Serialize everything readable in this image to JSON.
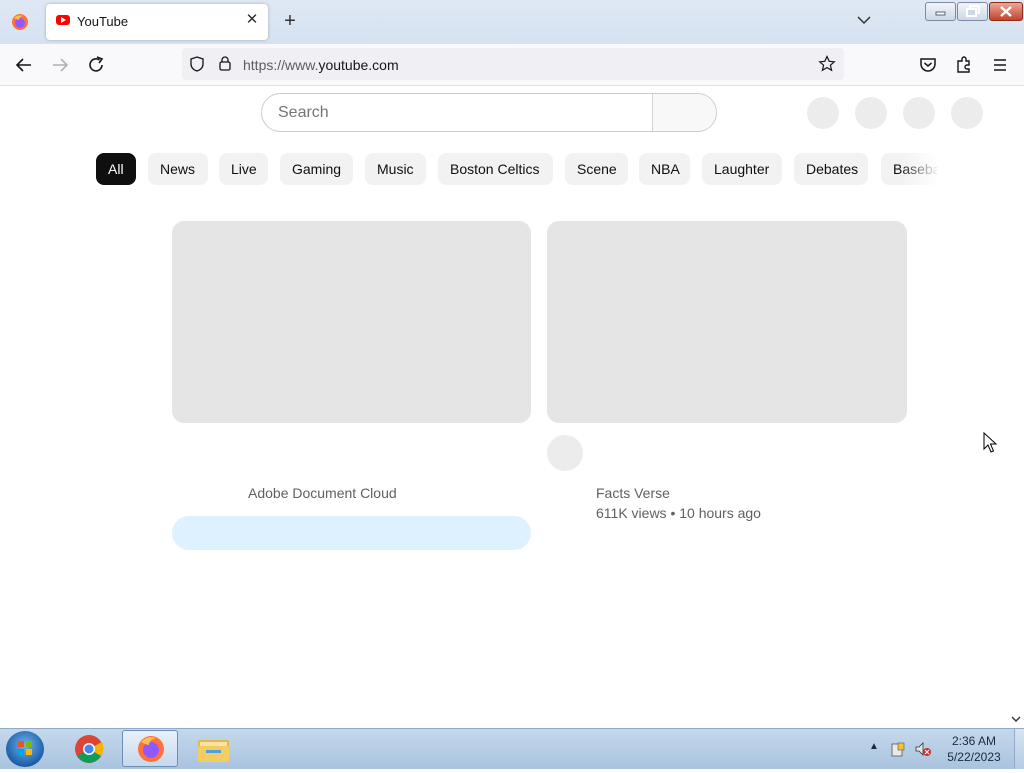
{
  "browser": {
    "tab_title": "YouTube",
    "url_prefix": "https://www.",
    "url_domain": "youtube.com"
  },
  "youtube": {
    "search_placeholder": "Search",
    "chips": [
      "All",
      "News",
      "Live",
      "Gaming",
      "Music",
      "Boston Celtics",
      "Scene",
      "NBA",
      "Laughter",
      "Debates",
      "Baseba"
    ],
    "videos": [
      {
        "channel": "Adobe Document Cloud",
        "meta": ""
      },
      {
        "channel": "Facts Verse",
        "meta": "611K views • 10 hours ago"
      }
    ]
  },
  "taskbar": {
    "time": "2:36 AM",
    "date": "5/22/2023"
  },
  "colors": {
    "youtube_red": "#ff0000",
    "chip_active": "#0f0f0f",
    "placeholder_gray": "#e5e5e5",
    "ad_cta_blue": "#def1ff"
  }
}
